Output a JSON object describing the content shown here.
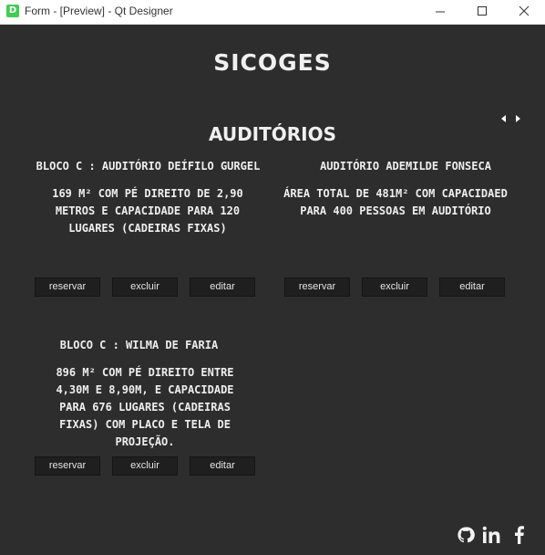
{
  "window": {
    "title": "Form - [Preview] - Qt Designer",
    "app_icon_letter": "D"
  },
  "header": {
    "app_name": "SICOGES",
    "section_title": "AUDITÓRIOS"
  },
  "cards": [
    {
      "title": "BLOCO C : AUDITÓRIO DEÍFILO GURGEL",
      "description": "169 M² COM PÉ DIREITO DE 2,90 METROS E CAPACIDADE PARA 120 LUGARES (CADEIRAS FIXAS)",
      "buttons": [
        "reservar",
        "excluir",
        "editar"
      ]
    },
    {
      "title": "AUDITÓRIO ADEMILDE FONSECA",
      "description": "ÁREA TOTAL DE 481M² COM CAPACIDAED PARA 400 PESSOAS EM AUDITÓRIO",
      "buttons": [
        "reservar",
        "excluir",
        "editar"
      ]
    },
    {
      "title": "BLOCO C : WILMA DE FARIA",
      "description": "896 M² COM PÉ DIREITO ENTRE 4,30M E 8,90M, E CAPACIDADE PARA 676 LUGARES (CADEIRAS FIXAS) COM PLACO E TELA DE PROJEÇÃO.",
      "buttons": [
        "reservar",
        "excluir",
        "editar"
      ]
    }
  ],
  "footer": {
    "social_icons": [
      "github-icon",
      "linkedin-icon",
      "facebook-icon"
    ]
  }
}
